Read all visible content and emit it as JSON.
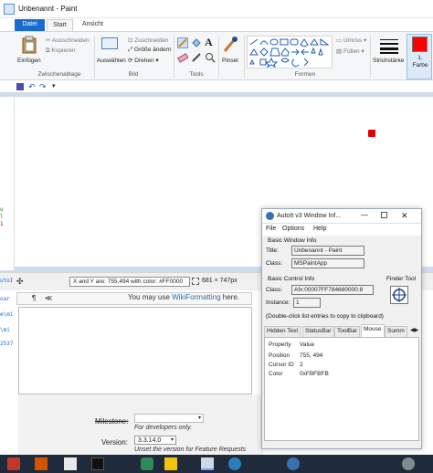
{
  "window": {
    "title": "Unbenannt - Paint"
  },
  "tabs": [
    "Datei",
    "Start",
    "Ansicht"
  ],
  "ribbon": {
    "clipboard": {
      "paste": "Einfügen",
      "cut": "Ausschneiden",
      "copy": "Kopieren",
      "group": "Zwischenablage"
    },
    "image": {
      "select": "Auswählen",
      "crop": "Zuschneiden",
      "resize": "Größe ändern",
      "rotate": "Drehen",
      "group": "Bild"
    },
    "tools": {
      "group": "Tools"
    },
    "brushes": {
      "label": "Pinsel"
    },
    "shapes": {
      "outline": "Umriss",
      "fill": "Füllen",
      "group": "Formen"
    },
    "size": {
      "label": "Strichstärke"
    },
    "color": {
      "label": "1. Farbe",
      "swatch": "#ff0000"
    }
  },
  "status": {
    "tooltip": "X and Y are: 755,494 with color: #FF0000",
    "dimensions": "681 × 747px"
  },
  "left_code": [
    "utoI",
    "oar",
    "e\\mi",
    "\\mi",
    "2537"
  ],
  "left_markers": [
    "u",
    "l",
    "1"
  ],
  "trac": {
    "wiki_prefix": "You may use ",
    "wiki_link": "WikiFormatting",
    "wiki_suffix": " here.",
    "milestone_label": "Milestone:",
    "milestone_hint": "For developers only.",
    "version_label": "Version:",
    "version_value": "3.3.14.0",
    "version_hint": "Unset the version for Feature Requests"
  },
  "autoit": {
    "title": "AutoIt v3 Window Inf...",
    "menu": [
      "File",
      "Options",
      "Help"
    ],
    "basic_window_label": "Basic Window Info",
    "title_label": "Title:",
    "title_value": "Unbenannt - Paint",
    "class_label": "Class:",
    "class_value": "MSPaintApp",
    "basic_control_label": "Basic Control Info",
    "finder_label": "Finder Tool",
    "ctrl_class_label": "Class:",
    "ctrl_class_value": "Afx:00007FF784680000:8",
    "instance_label": "Instance:",
    "instance_value": "1",
    "hint": "(Double-click list entries to copy to clipboard)",
    "tabs": [
      "Hidden Text",
      "StatusBar",
      "ToolBar",
      "Mouse",
      "Summ"
    ],
    "headers": [
      "Property",
      "Value"
    ],
    "rows": [
      [
        "Position",
        "755, 494"
      ],
      [
        "Cursor ID",
        "2"
      ],
      [
        "Color",
        "0xFBFBFB"
      ]
    ]
  }
}
